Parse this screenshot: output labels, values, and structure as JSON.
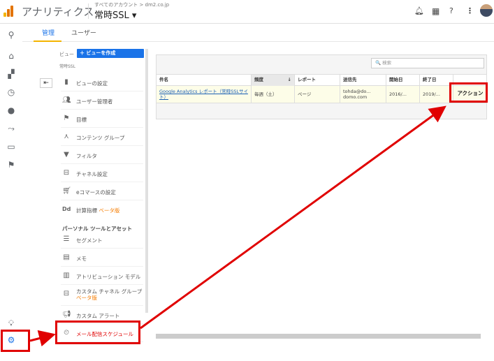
{
  "header": {
    "app_title": "アナリティクス",
    "breadcrumb": "すべてのアカウント > dm2.co.jp",
    "property": "常時SSL ▾"
  },
  "tabs": [
    {
      "label": "管理"
    },
    {
      "label": "ユーザー"
    }
  ],
  "view_panel": {
    "view_label": "ビュー",
    "create_label": "＋ ビューを作成",
    "view_name": "常時SSL",
    "back_label": "⇤",
    "items": [
      {
        "label": "ビューの設定",
        "icon": "file-icon"
      },
      {
        "label": "ユーザー管理者",
        "icon": "people-icon"
      },
      {
        "label": "目標",
        "icon": "flag-icon"
      },
      {
        "label": "コンテンツ グループ",
        "icon": "person-icon"
      },
      {
        "label": "フィルタ",
        "icon": "filter-icon"
      },
      {
        "label": "チャネル設定",
        "icon": "channel-icon"
      },
      {
        "label": "eコマースの設定",
        "icon": "cart-icon"
      },
      {
        "label": "計算指標",
        "beta": "ベータ版",
        "icon": "dd-icon"
      }
    ],
    "section_title": "パーソナル ツールとアセット",
    "personal_items": [
      {
        "label": "セグメント",
        "icon": "segment-icon"
      },
      {
        "label": "メモ",
        "icon": "memo-icon"
      },
      {
        "label": "アトリビューション モデル",
        "icon": "bar-chart-icon"
      },
      {
        "label": "カスタム チャネル グループ",
        "beta": "ベータ版",
        "icon": "channel-icon"
      },
      {
        "label": "カスタム アラート",
        "icon": "megaphone-icon"
      },
      {
        "label": "メール配信スケジュール",
        "icon": "clock-icon"
      }
    ]
  },
  "table": {
    "search_placeholder": "🔍 検索",
    "columns": [
      "件名",
      "頻度",
      "レポート",
      "送信先",
      "開始日",
      "終了日"
    ],
    "sort_indicator": "↓",
    "rows": [
      {
        "subject": "Google Analytics レポート（常時SSLサイト）",
        "frequency": "毎週（土）",
        "report": "ページ",
        "recipient": "tohda@do... domo.com",
        "start": "2016/...",
        "end": "2019/...",
        "action": "アクション"
      }
    ]
  },
  "colors": {
    "highlight": "#e00000",
    "accent": "#1a73e8",
    "tab_underline": "#f4b400",
    "logo": [
      "#f4b400",
      "#e37400",
      "#e37400"
    ]
  }
}
